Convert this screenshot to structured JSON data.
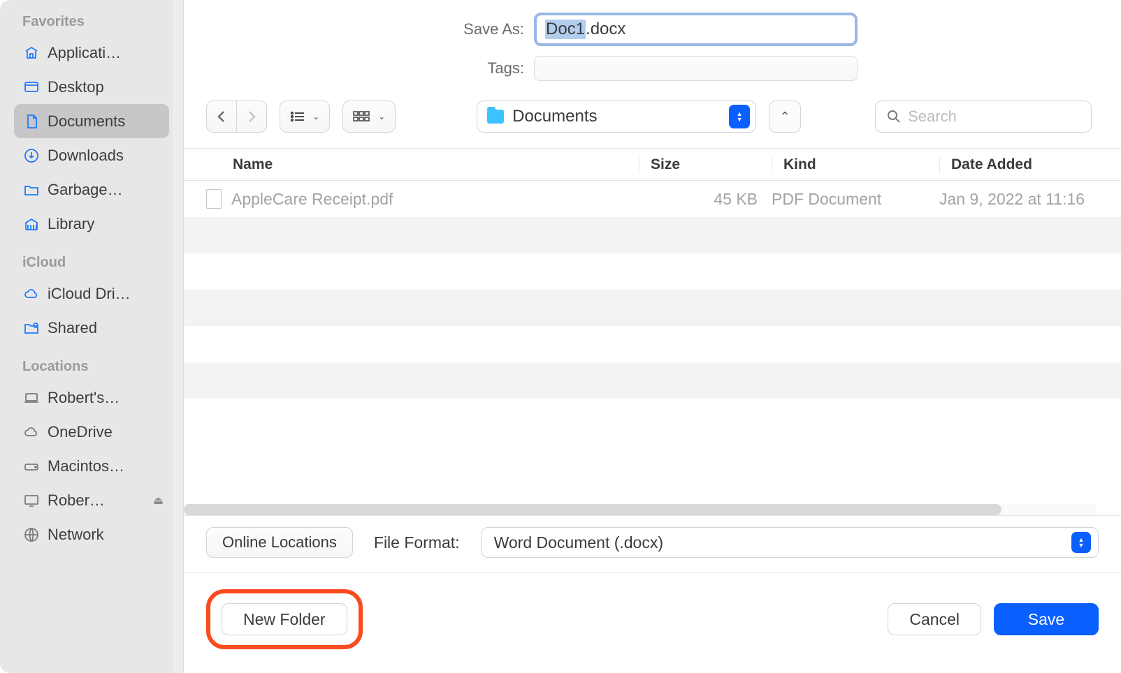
{
  "sidebar": {
    "sections": [
      {
        "title": "Favorites",
        "items": [
          {
            "label": "Applicati…",
            "icon": "apps"
          },
          {
            "label": "Desktop",
            "icon": "desktop"
          },
          {
            "label": "Documents",
            "icon": "doc",
            "selected": true
          },
          {
            "label": "Downloads",
            "icon": "download"
          },
          {
            "label": "Garbage…",
            "icon": "folder"
          },
          {
            "label": "Library",
            "icon": "library"
          }
        ]
      },
      {
        "title": "iCloud",
        "items": [
          {
            "label": "iCloud Dri…",
            "icon": "cloud"
          },
          {
            "label": "Shared",
            "icon": "shared"
          }
        ]
      },
      {
        "title": "Locations",
        "items": [
          {
            "label": "Robert's…",
            "icon": "laptop",
            "gray": true
          },
          {
            "label": "OneDrive",
            "icon": "cloud",
            "gray": true
          },
          {
            "label": "Macintos…",
            "icon": "drive",
            "gray": true
          },
          {
            "label": "Rober…",
            "icon": "display",
            "gray": true,
            "eject": true
          },
          {
            "label": "Network",
            "icon": "globe",
            "gray": true
          }
        ]
      }
    ]
  },
  "top": {
    "save_as_label": "Save As:",
    "filename_selected": "Doc1",
    "filename_rest": ".docx",
    "tags_label": "Tags:"
  },
  "toolbar": {
    "current_folder": "Documents",
    "search_placeholder": "Search"
  },
  "columns": [
    "Name",
    "Size",
    "Kind",
    "Date Added"
  ],
  "files": [
    {
      "name": "AppleCare Receipt.pdf",
      "size": "45 KB",
      "kind": "PDF Document",
      "date": "Jan 9, 2022 at 11:16"
    }
  ],
  "format_row": {
    "online_locations": "Online Locations",
    "format_label": "File Format:",
    "format_value": "Word Document (.docx)"
  },
  "buttons": {
    "new_folder": "New Folder",
    "cancel": "Cancel",
    "save": "Save"
  }
}
